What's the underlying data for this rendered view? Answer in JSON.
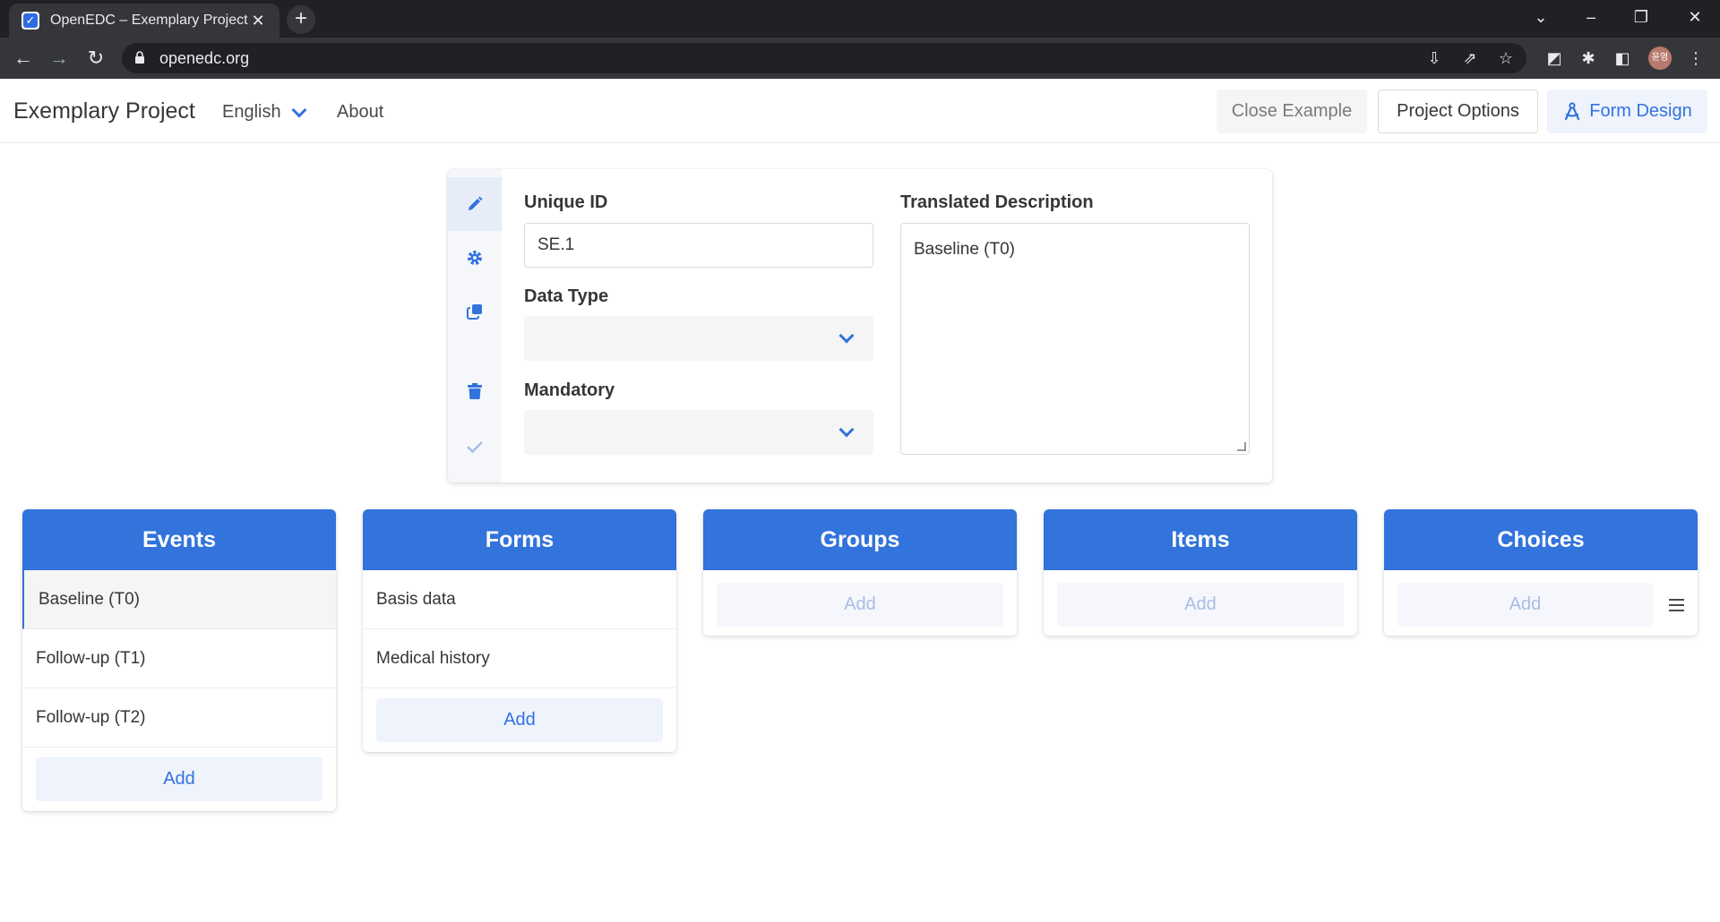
{
  "browser": {
    "tab_title": "OpenEDC – Exemplary Project",
    "favicon": "check-icon",
    "url": "openedc.org",
    "avatar_text": "윤영"
  },
  "header": {
    "brand": "Exemplary Project",
    "language": "English",
    "about": "About",
    "close_example": "Close Example",
    "project_options": "Project Options",
    "form_design": "Form Design"
  },
  "editor": {
    "sidebar_icons": [
      "pencil-icon",
      "gear-icon",
      "copy-icon",
      "trash-icon",
      "check-icon"
    ],
    "unique_id_label": "Unique ID",
    "unique_id_value": "SE.1",
    "data_type_label": "Data Type",
    "data_type_value": "",
    "mandatory_label": "Mandatory",
    "mandatory_value": "",
    "description_label": "Translated Description",
    "description_value": "Baseline (T0)"
  },
  "columns": {
    "events": {
      "title": "Events",
      "items": [
        "Baseline (T0)",
        "Follow-up (T1)",
        "Follow-up (T2)"
      ],
      "add": "Add"
    },
    "forms": {
      "title": "Forms",
      "items": [
        "Basis data",
        "Medical history"
      ],
      "add": "Add"
    },
    "groups": {
      "title": "Groups",
      "add": "Add"
    },
    "items": {
      "title": "Items",
      "add": "Add"
    },
    "choices": {
      "title": "Choices",
      "add": "Add"
    }
  },
  "colors": {
    "primary": "#3273dc",
    "light": "#eef3fc"
  }
}
